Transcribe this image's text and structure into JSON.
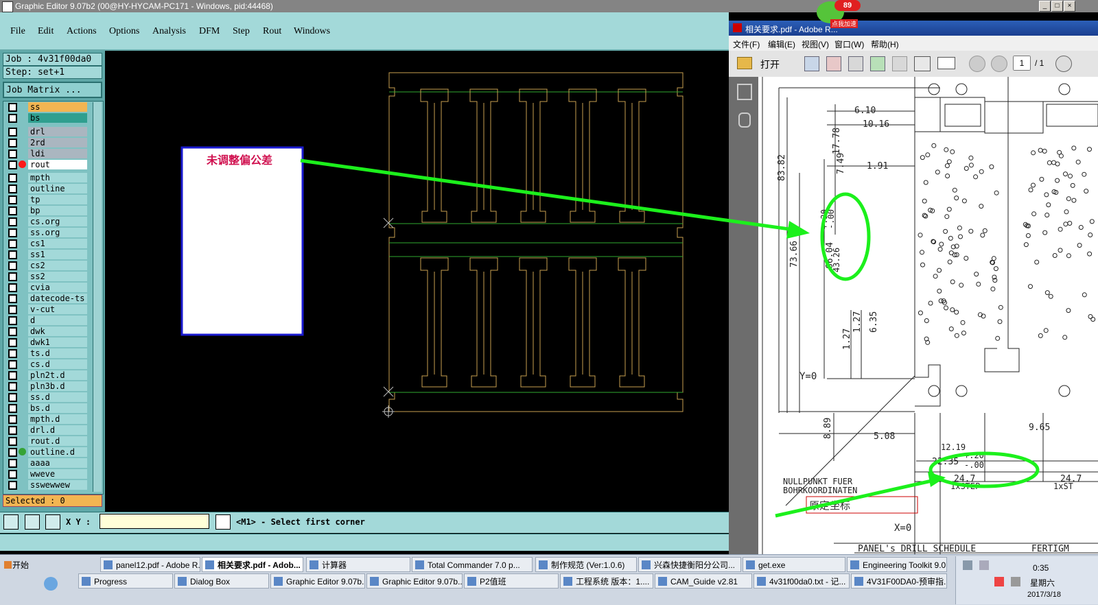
{
  "genesis": {
    "title": "Graphic Editor 9.07b2 (00@HY-HYCAM-PC171 - Windows, pid:44468)",
    "menu": [
      "File",
      "Edit",
      "Actions",
      "Options",
      "Analysis",
      "DFM",
      "Step",
      "Rout",
      "Windows"
    ],
    "job_label": "Job : 4v31f00da0",
    "step_label": "Step: set+1",
    "matrix_button": "Job Matrix ...",
    "layers": [
      {
        "name": "ss",
        "color": "#f2b552",
        "dot": ""
      },
      {
        "name": "bs",
        "color": "#2f9f8f",
        "dot": ""
      },
      {
        "name": "drl",
        "color": "#aab6c0",
        "dot": ""
      },
      {
        "name": "2rd",
        "color": "#aab6c0",
        "dot": ""
      },
      {
        "name": "ldi",
        "color": "#aab6c0",
        "dot": ""
      },
      {
        "name": "rout",
        "color": "#ffffff",
        "dot": "#ff1a1a"
      },
      {
        "name": "mpth",
        "color": "#a3d9d9",
        "dot": ""
      },
      {
        "name": "outline",
        "color": "#a3d9d9",
        "dot": ""
      },
      {
        "name": "tp",
        "color": "#a3d9d9",
        "dot": ""
      },
      {
        "name": "bp",
        "color": "#a3d9d9",
        "dot": ""
      },
      {
        "name": "cs.org",
        "color": "#a3d9d9",
        "dot": ""
      },
      {
        "name": "ss.org",
        "color": "#a3d9d9",
        "dot": ""
      },
      {
        "name": "cs1",
        "color": "#a3d9d9",
        "dot": ""
      },
      {
        "name": "ss1",
        "color": "#a3d9d9",
        "dot": ""
      },
      {
        "name": "cs2",
        "color": "#a3d9d9",
        "dot": ""
      },
      {
        "name": "ss2",
        "color": "#a3d9d9",
        "dot": ""
      },
      {
        "name": "cvia",
        "color": "#a3d9d9",
        "dot": ""
      },
      {
        "name": "datecode-ts",
        "color": "#a3d9d9",
        "dot": ""
      },
      {
        "name": "v-cut",
        "color": "#a3d9d9",
        "dot": ""
      },
      {
        "name": "d",
        "color": "#a3d9d9",
        "dot": ""
      },
      {
        "name": "dwk",
        "color": "#a3d9d9",
        "dot": ""
      },
      {
        "name": "dwk1",
        "color": "#a3d9d9",
        "dot": ""
      },
      {
        "name": "ts.d",
        "color": "#a3d9d9",
        "dot": ""
      },
      {
        "name": "cs.d",
        "color": "#a3d9d9",
        "dot": ""
      },
      {
        "name": "pln2t.d",
        "color": "#a3d9d9",
        "dot": ""
      },
      {
        "name": "pln3b.d",
        "color": "#a3d9d9",
        "dot": ""
      },
      {
        "name": "ss.d",
        "color": "#a3d9d9",
        "dot": ""
      },
      {
        "name": "bs.d",
        "color": "#a3d9d9",
        "dot": ""
      },
      {
        "name": "mpth.d",
        "color": "#a3d9d9",
        "dot": ""
      },
      {
        "name": "drl.d",
        "color": "#a3d9d9",
        "dot": ""
      },
      {
        "name": "rout.d",
        "color": "#a3d9d9",
        "dot": ""
      },
      {
        "name": "outline.d",
        "color": "#a3d9d9",
        "dot": "#35a335"
      },
      {
        "name": "aaaa",
        "color": "#a3d9d9",
        "dot": ""
      },
      {
        "name": "wweve",
        "color": "#a3d9d9",
        "dot": ""
      },
      {
        "name": "sswewwew",
        "color": "#a3d9d9",
        "dot": ""
      }
    ],
    "selected_label": "Selected : 0",
    "xy_label": "X Y :",
    "xy_value": "",
    "prompt": "<M1> - Select first corner",
    "annotation_note": "未调整偏公差"
  },
  "pdf": {
    "title": "相关要求.pdf - Adobe R...",
    "menu": [
      "文件(F)",
      "编辑(E)",
      "视图(V)",
      "窗口(W)",
      "帮助(H)"
    ],
    "open_label": "打开",
    "page_current": "1",
    "page_total": "/ 1",
    "badge": "89",
    "badge_caption": "点我加速",
    "drawing": {
      "dims": [
        "6.10",
        "10.16",
        "17.78",
        "7.49",
        "1.91",
        "83.82",
        "73.66",
        "66.04",
        "+.20",
        "-.00",
        "43.26",
        "1.27",
        "1.27",
        "6.35",
        "Y=0",
        "8.89",
        "5.08",
        "12.19",
        "9.65",
        "22.35",
        "+.20",
        "-.00",
        "24.7",
        "24.7",
        "1xSTEP",
        "1xST",
        "X=0"
      ],
      "nullpunkt_line1": "NULLPUNKT FUER",
      "nullpunkt_line2": "BOHRKOORDINATEN",
      "origin_note": "原定坐标",
      "footer": "PANEL's DRILL SCHEDULE",
      "footer_right": "FERTIGM"
    }
  },
  "taskbar": {
    "start": "开始",
    "row1": [
      {
        "label": "panel12.pdf - Adobe R...",
        "active": false
      },
      {
        "label": "相关要求.pdf - Adob...",
        "active": true
      },
      {
        "label": "计算器",
        "active": false
      },
      {
        "label": "Total Commander 7.0 p...",
        "active": false
      },
      {
        "label": "制作规范 (Ver:1.0.6)",
        "active": false
      },
      {
        "label": "兴森快捷衡阳分公司...",
        "active": false
      },
      {
        "label": "get.exe",
        "active": false
      },
      {
        "label": "Engineering Toolkit 9.0...",
        "active": false
      }
    ],
    "row2": [
      {
        "label": "Progress",
        "active": false
      },
      {
        "label": "Dialog Box",
        "active": false
      },
      {
        "label": "Graphic Editor 9.07b...",
        "active": false
      },
      {
        "label": "Graphic Editor 9.07b...",
        "active": false
      },
      {
        "label": "P2值班",
        "active": false
      },
      {
        "label": "工程系统  版本：1....",
        "active": false
      },
      {
        "label": "CAM_Guide v2.81",
        "active": false
      },
      {
        "label": "4v31f00da0.txt - 记...",
        "active": false
      },
      {
        "label": "4V31F00DA0-预审指...",
        "active": false
      }
    ],
    "clock": "0:35",
    "weekday": "星期六",
    "date": "2017/3/18"
  }
}
